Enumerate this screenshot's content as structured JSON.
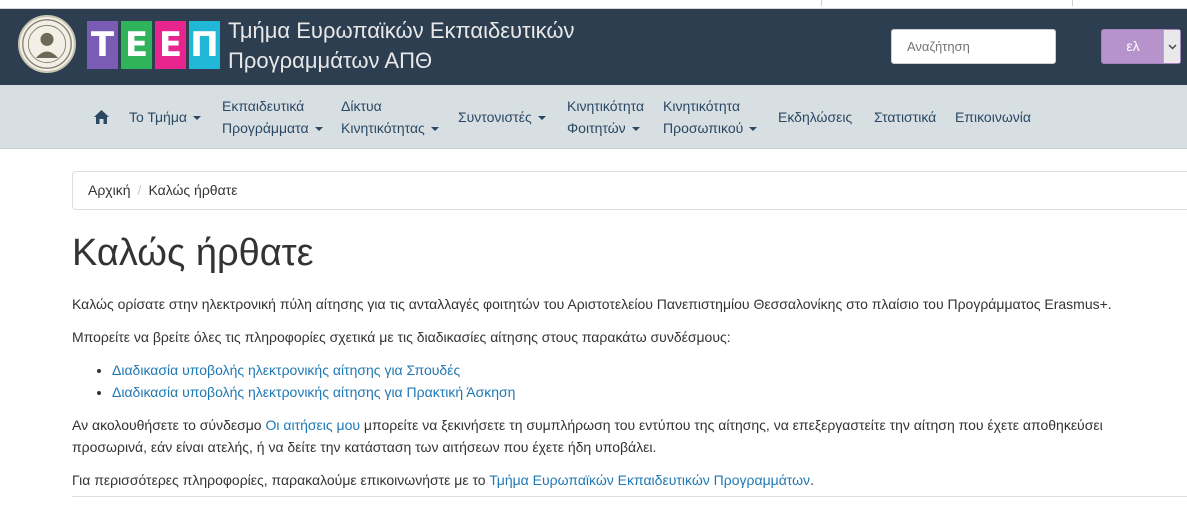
{
  "header": {
    "logo_letters": [
      {
        "char": "Τ",
        "color": "#7a5cb5"
      },
      {
        "char": "Ε",
        "color": "#2fb45b"
      },
      {
        "char": "Ε",
        "color": "#e8248e"
      },
      {
        "char": "Π",
        "color": "#21b8d8"
      }
    ],
    "title_line1": "Τμήμα Ευρωπαϊκών Εκπαιδευτικών",
    "title_line2": "Προγραμμάτων ΑΠΘ",
    "search_placeholder": "Αναζήτηση",
    "language": "ελ",
    "language_bg": "#b793cc"
  },
  "nav": {
    "home_icon": "home-icon",
    "items": [
      {
        "label": "Το Τμήμα",
        "dropdown": true
      },
      {
        "label_line1": "Εκπαιδευτικά",
        "label_line2": "Προγράμματα",
        "dropdown": true
      },
      {
        "label_line1": "Δίκτυα",
        "label_line2": "Κινητικότητας",
        "dropdown": true
      },
      {
        "label": "Συντονιστές",
        "dropdown": true
      },
      {
        "label_line1": "Κινητικότητα",
        "label_line2": "Φοιτητών",
        "dropdown": true
      },
      {
        "label_line1": "Κινητικότητα",
        "label_line2": "Προσωπικού",
        "dropdown": true
      },
      {
        "label": "Εκδηλώσεις",
        "dropdown": false
      },
      {
        "label": "Στατιστικά",
        "dropdown": false
      },
      {
        "label": "Επικοινωνία",
        "dropdown": false
      }
    ]
  },
  "breadcrumb": {
    "home": "Αρχική",
    "separator": "/",
    "current": "Καλώς ήρθατε"
  },
  "page": {
    "title": "Καλώς ήρθατε",
    "intro": "Καλώς ορίσατε στην ηλεκτρονική πύλη αίτησης για τις ανταλλαγές φοιτητών του Αριστοτελείου Πανεπιστημίου Θεσσαλονίκης στο πλαίσιο του Προγράμματος Erasmus+.",
    "info": "Μπορείτε να βρείτε όλες τις πληροφορίες σχετικά με τις διαδικασίες αίτησης στους παρακάτω συνδέσμους:",
    "links": [
      "Διαδικασία υποβολής ηλεκτρονικής αίτησης για Σπουδές",
      "Διαδικασία υποβολής ηλεκτρονικής αίτησης για Πρακτική Άσκηση"
    ],
    "follow_pre": "Αν ακολουθήσετε το σύνδεσμο ",
    "follow_link": "Οι αιτήσεις μου",
    "follow_post": " μπορείτε να ξεκινήσετε τη συμπλήρωση του εντύπου της αίτησης, να επεξεργαστείτε την αίτηση που έχετε αποθηκεύσει προσωρινά, εάν είναι ατελής, ή να δείτε την κατάσταση των αιτήσεων που έχετε ήδη υποβάλει.",
    "contact_pre": "Για περισσότερες πληροφορίες, παρακαλούμε επικοινωνήστε με το ",
    "contact_link": "Τμήμα Ευρωπαϊκών Εκπαιδευτικών Προγραμμάτων",
    "contact_post": "."
  },
  "colors": {
    "header_bg": "#2c3e50",
    "nav_bg": "#d8dfe3",
    "link": "#1f78b4"
  }
}
